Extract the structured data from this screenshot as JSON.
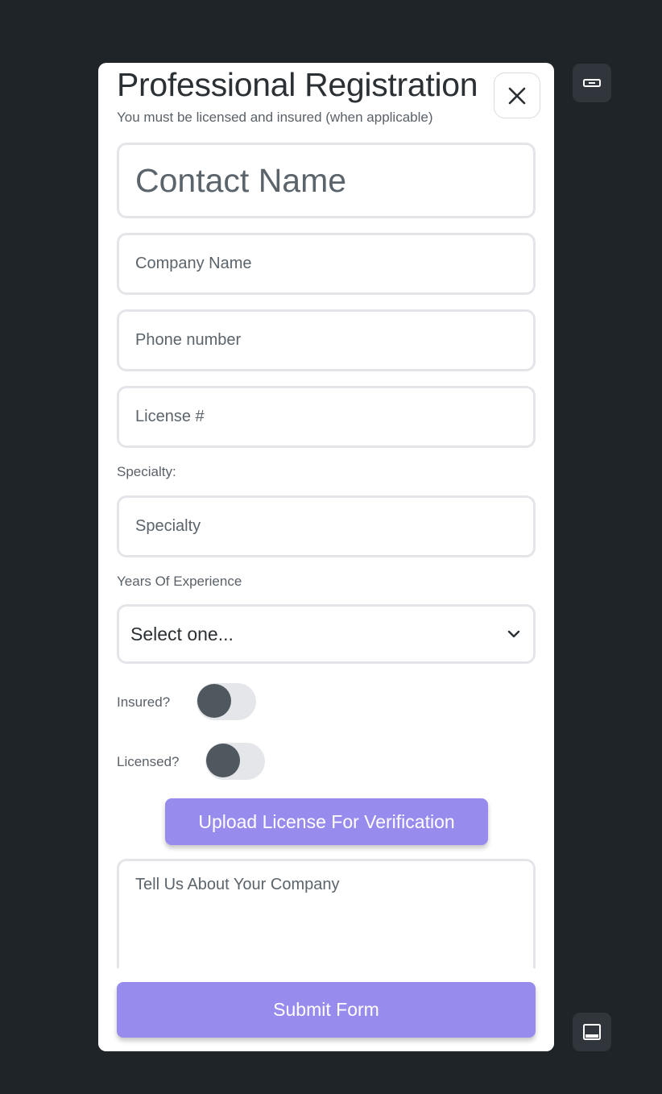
{
  "modal": {
    "title": "Professional Registration",
    "subtitle": "You must be licensed and insured (when applicable)",
    "close_icon": "close-icon"
  },
  "form": {
    "contact_name_placeholder": "Contact Name",
    "company_name_placeholder": "Company Name",
    "phone_placeholder": "Phone number",
    "license_placeholder": "License #",
    "specialty_label": "Specialty:",
    "specialty_placeholder": "Specialty",
    "experience_label": "Years Of Experience",
    "experience_selected": "Select one...",
    "experience_icon": "chevron-down-icon",
    "insured_label": "Insured?",
    "insured_on": false,
    "licensed_label": "Licensed?",
    "licensed_on": false,
    "upload_label": "Upload License For Verification",
    "about_placeholder": "Tell Us About Your Company",
    "submit_label": "Submit Form"
  },
  "side_controls": {
    "top_icon": "minimize-icon",
    "bottom_icon": "panel-bottom-icon"
  },
  "colors": {
    "background": "#1f2428",
    "accent": "#978cee",
    "toggle_track": "#e4e6e9",
    "toggle_knob": "#4f585f"
  }
}
